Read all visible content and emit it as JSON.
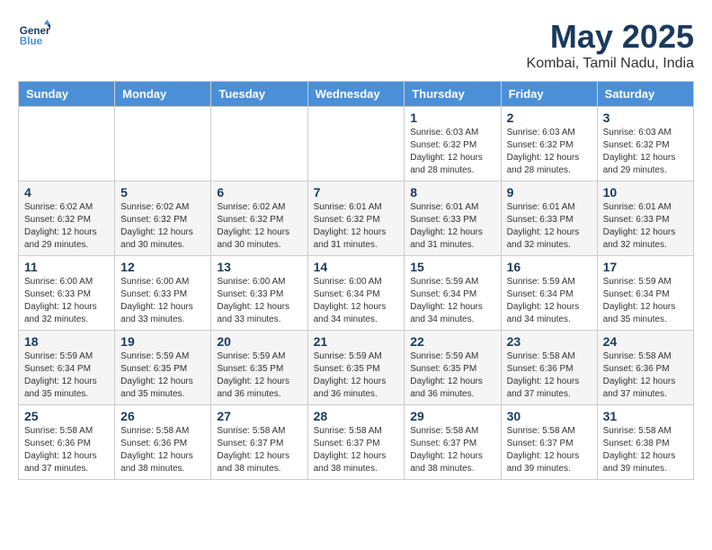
{
  "logo": {
    "name": "General",
    "name2": "Blue"
  },
  "title": "May 2025",
  "location": "Kombai, Tamil Nadu, India",
  "days_of_week": [
    "Sunday",
    "Monday",
    "Tuesday",
    "Wednesday",
    "Thursday",
    "Friday",
    "Saturday"
  ],
  "weeks": [
    [
      {
        "day": "",
        "info": ""
      },
      {
        "day": "",
        "info": ""
      },
      {
        "day": "",
        "info": ""
      },
      {
        "day": "",
        "info": ""
      },
      {
        "day": "1",
        "info": "Sunrise: 6:03 AM\nSunset: 6:32 PM\nDaylight: 12 hours\nand 28 minutes."
      },
      {
        "day": "2",
        "info": "Sunrise: 6:03 AM\nSunset: 6:32 PM\nDaylight: 12 hours\nand 28 minutes."
      },
      {
        "day": "3",
        "info": "Sunrise: 6:03 AM\nSunset: 6:32 PM\nDaylight: 12 hours\nand 29 minutes."
      }
    ],
    [
      {
        "day": "4",
        "info": "Sunrise: 6:02 AM\nSunset: 6:32 PM\nDaylight: 12 hours\nand 29 minutes."
      },
      {
        "day": "5",
        "info": "Sunrise: 6:02 AM\nSunset: 6:32 PM\nDaylight: 12 hours\nand 30 minutes."
      },
      {
        "day": "6",
        "info": "Sunrise: 6:02 AM\nSunset: 6:32 PM\nDaylight: 12 hours\nand 30 minutes."
      },
      {
        "day": "7",
        "info": "Sunrise: 6:01 AM\nSunset: 6:32 PM\nDaylight: 12 hours\nand 31 minutes."
      },
      {
        "day": "8",
        "info": "Sunrise: 6:01 AM\nSunset: 6:33 PM\nDaylight: 12 hours\nand 31 minutes."
      },
      {
        "day": "9",
        "info": "Sunrise: 6:01 AM\nSunset: 6:33 PM\nDaylight: 12 hours\nand 32 minutes."
      },
      {
        "day": "10",
        "info": "Sunrise: 6:01 AM\nSunset: 6:33 PM\nDaylight: 12 hours\nand 32 minutes."
      }
    ],
    [
      {
        "day": "11",
        "info": "Sunrise: 6:00 AM\nSunset: 6:33 PM\nDaylight: 12 hours\nand 32 minutes."
      },
      {
        "day": "12",
        "info": "Sunrise: 6:00 AM\nSunset: 6:33 PM\nDaylight: 12 hours\nand 33 minutes."
      },
      {
        "day": "13",
        "info": "Sunrise: 6:00 AM\nSunset: 6:33 PM\nDaylight: 12 hours\nand 33 minutes."
      },
      {
        "day": "14",
        "info": "Sunrise: 6:00 AM\nSunset: 6:34 PM\nDaylight: 12 hours\nand 34 minutes."
      },
      {
        "day": "15",
        "info": "Sunrise: 5:59 AM\nSunset: 6:34 PM\nDaylight: 12 hours\nand 34 minutes."
      },
      {
        "day": "16",
        "info": "Sunrise: 5:59 AM\nSunset: 6:34 PM\nDaylight: 12 hours\nand 34 minutes."
      },
      {
        "day": "17",
        "info": "Sunrise: 5:59 AM\nSunset: 6:34 PM\nDaylight: 12 hours\nand 35 minutes."
      }
    ],
    [
      {
        "day": "18",
        "info": "Sunrise: 5:59 AM\nSunset: 6:34 PM\nDaylight: 12 hours\nand 35 minutes."
      },
      {
        "day": "19",
        "info": "Sunrise: 5:59 AM\nSunset: 6:35 PM\nDaylight: 12 hours\nand 35 minutes."
      },
      {
        "day": "20",
        "info": "Sunrise: 5:59 AM\nSunset: 6:35 PM\nDaylight: 12 hours\nand 36 minutes."
      },
      {
        "day": "21",
        "info": "Sunrise: 5:59 AM\nSunset: 6:35 PM\nDaylight: 12 hours\nand 36 minutes."
      },
      {
        "day": "22",
        "info": "Sunrise: 5:59 AM\nSunset: 6:35 PM\nDaylight: 12 hours\nand 36 minutes."
      },
      {
        "day": "23",
        "info": "Sunrise: 5:58 AM\nSunset: 6:36 PM\nDaylight: 12 hours\nand 37 minutes."
      },
      {
        "day": "24",
        "info": "Sunrise: 5:58 AM\nSunset: 6:36 PM\nDaylight: 12 hours\nand 37 minutes."
      }
    ],
    [
      {
        "day": "25",
        "info": "Sunrise: 5:58 AM\nSunset: 6:36 PM\nDaylight: 12 hours\nand 37 minutes."
      },
      {
        "day": "26",
        "info": "Sunrise: 5:58 AM\nSunset: 6:36 PM\nDaylight: 12 hours\nand 38 minutes."
      },
      {
        "day": "27",
        "info": "Sunrise: 5:58 AM\nSunset: 6:37 PM\nDaylight: 12 hours\nand 38 minutes."
      },
      {
        "day": "28",
        "info": "Sunrise: 5:58 AM\nSunset: 6:37 PM\nDaylight: 12 hours\nand 38 minutes."
      },
      {
        "day": "29",
        "info": "Sunrise: 5:58 AM\nSunset: 6:37 PM\nDaylight: 12 hours\nand 38 minutes."
      },
      {
        "day": "30",
        "info": "Sunrise: 5:58 AM\nSunset: 6:37 PM\nDaylight: 12 hours\nand 39 minutes."
      },
      {
        "day": "31",
        "info": "Sunrise: 5:58 AM\nSunset: 6:38 PM\nDaylight: 12 hours\nand 39 minutes."
      }
    ]
  ]
}
